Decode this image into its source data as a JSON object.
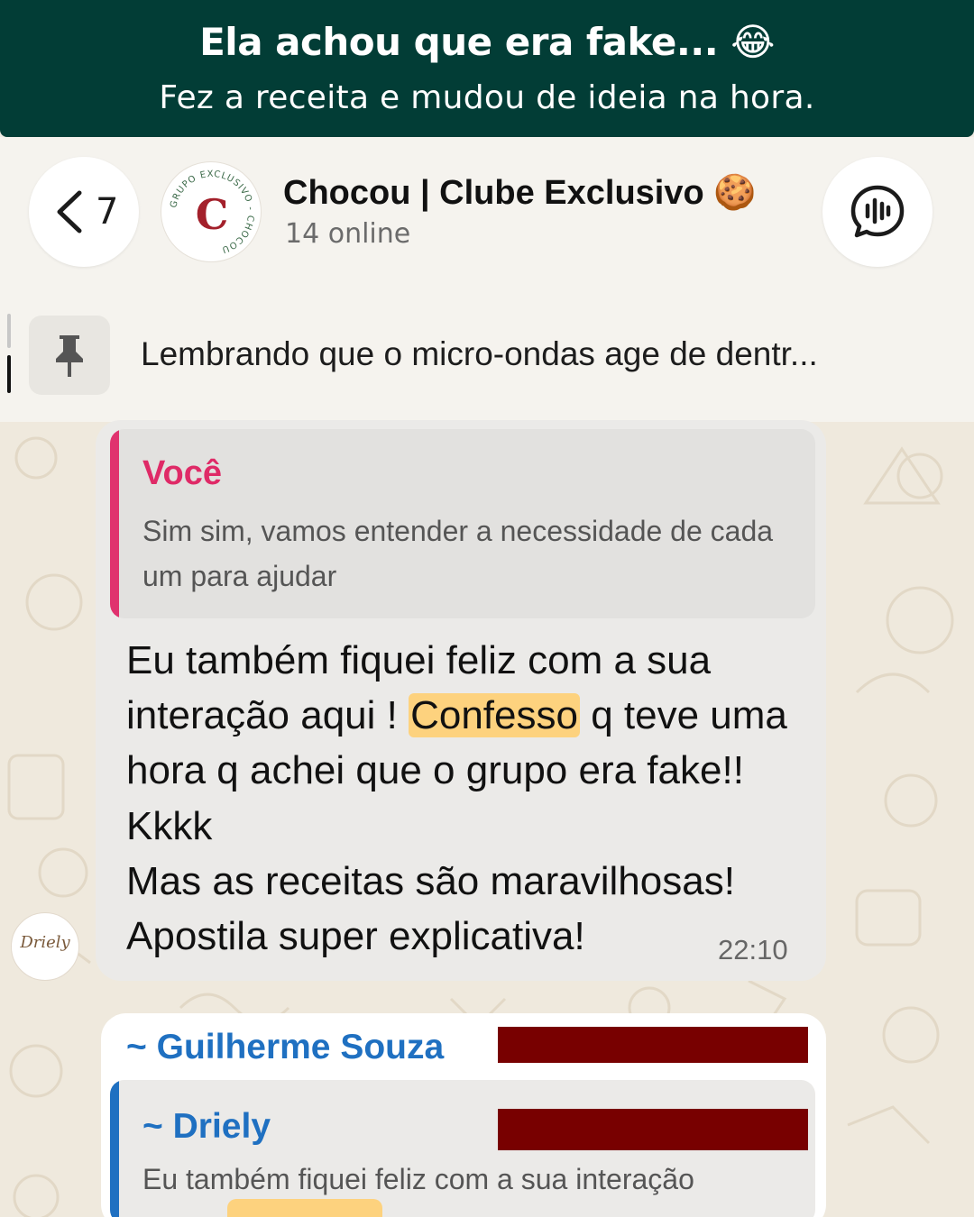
{
  "banner": {
    "title": "Ela achou que era fake... 😂",
    "subtitle": "Fez a receita e mudou de ideia na hora."
  },
  "header": {
    "back_count": "7",
    "group_avatar_text": "GRUPO EXCLUSIVO - CHOCOU",
    "group_avatar_letter": "C",
    "group_name": "Chocou | Clube Exclusivo 🍪",
    "online_status": "14 online",
    "back_icon": "chevron-left-icon",
    "call_icon": "voice-chat-icon"
  },
  "pinned": {
    "icon": "pin-icon",
    "text": "Lembrando que o micro-ondas age de dentr..."
  },
  "messages": [
    {
      "quote_author": "Você",
      "quote_text": "Sim sim, vamos entender a necessidade de cada um para ajudar",
      "text_before": "Eu também fiquei feliz com a sua interação aqui ! ",
      "highlight": "Confesso",
      "text_after": " q teve uma hora q achei que o grupo era fake!! Kkkk",
      "line2": "Mas as receitas são maravilhosas!",
      "line3": "Apostila super explicativa!",
      "time": "22:10",
      "sender_avatar_text": "Driely"
    },
    {
      "sender": "~ Guilherme Souza",
      "quote_author": "~ Driely",
      "quote_text": "Eu também fiquei feliz com a sua interação"
    }
  ],
  "colors": {
    "banner_bg": "#023d36",
    "you_color": "#df2a67",
    "name_color": "#1f70c1",
    "highlight": "#fdd27e",
    "redaction": "#780000"
  }
}
